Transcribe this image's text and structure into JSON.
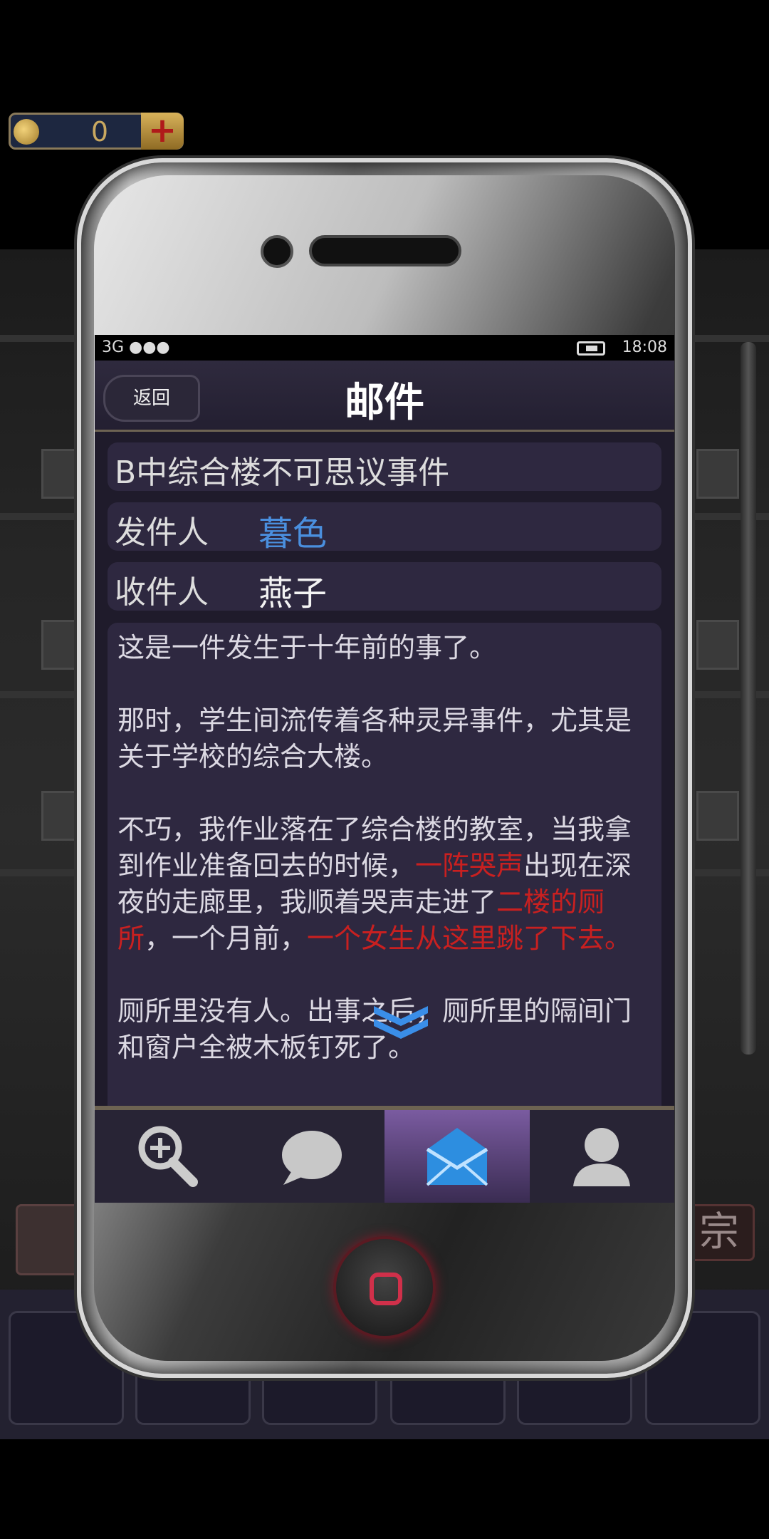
{
  "coin_bar": {
    "count": "0",
    "add_label": "+"
  },
  "status_bar": {
    "network": "3G ●●●",
    "time": "18:08"
  },
  "nav": {
    "back_label": "返回",
    "title": "邮件"
  },
  "mail": {
    "subject": "B中综合楼不可思议事件",
    "sender_label": "发件人",
    "sender": "暮色",
    "receiver_label": "收件人",
    "receiver": "燕子",
    "body": {
      "p1": "这是一件发生于十年前的事了。",
      "p2": "那时，学生间流传着各种灵异事件，尤其是关于学校的综合大楼。",
      "p3_a": "不巧，我作业落在了综合楼的教室，当我拿到作业准备回去的时候，",
      "p3_red1": "一阵哭声",
      "p3_b": "出现在深夜的走廊里，我顺着哭声走进了",
      "p3_red2": "二楼的厕所",
      "p3_c": "，一个月前，",
      "p3_red3": "一个女生从这里跳了下去。",
      "p4": "厕所里没有人。出事之后，厕所里的隔间门和窗户全被木板钉死了。"
    }
  },
  "tabs": [
    {
      "icon": "magnifier-icon",
      "active": false
    },
    {
      "icon": "chat-bubble-icon",
      "active": false
    },
    {
      "icon": "mail-envelope-icon",
      "active": true
    },
    {
      "icon": "user-icon",
      "active": false
    }
  ],
  "background": {
    "right_item_char": "宗"
  },
  "colors": {
    "accent_red": "#c92020",
    "sender_blue": "#4a8fde",
    "tab_active": "#7a5ba0"
  }
}
